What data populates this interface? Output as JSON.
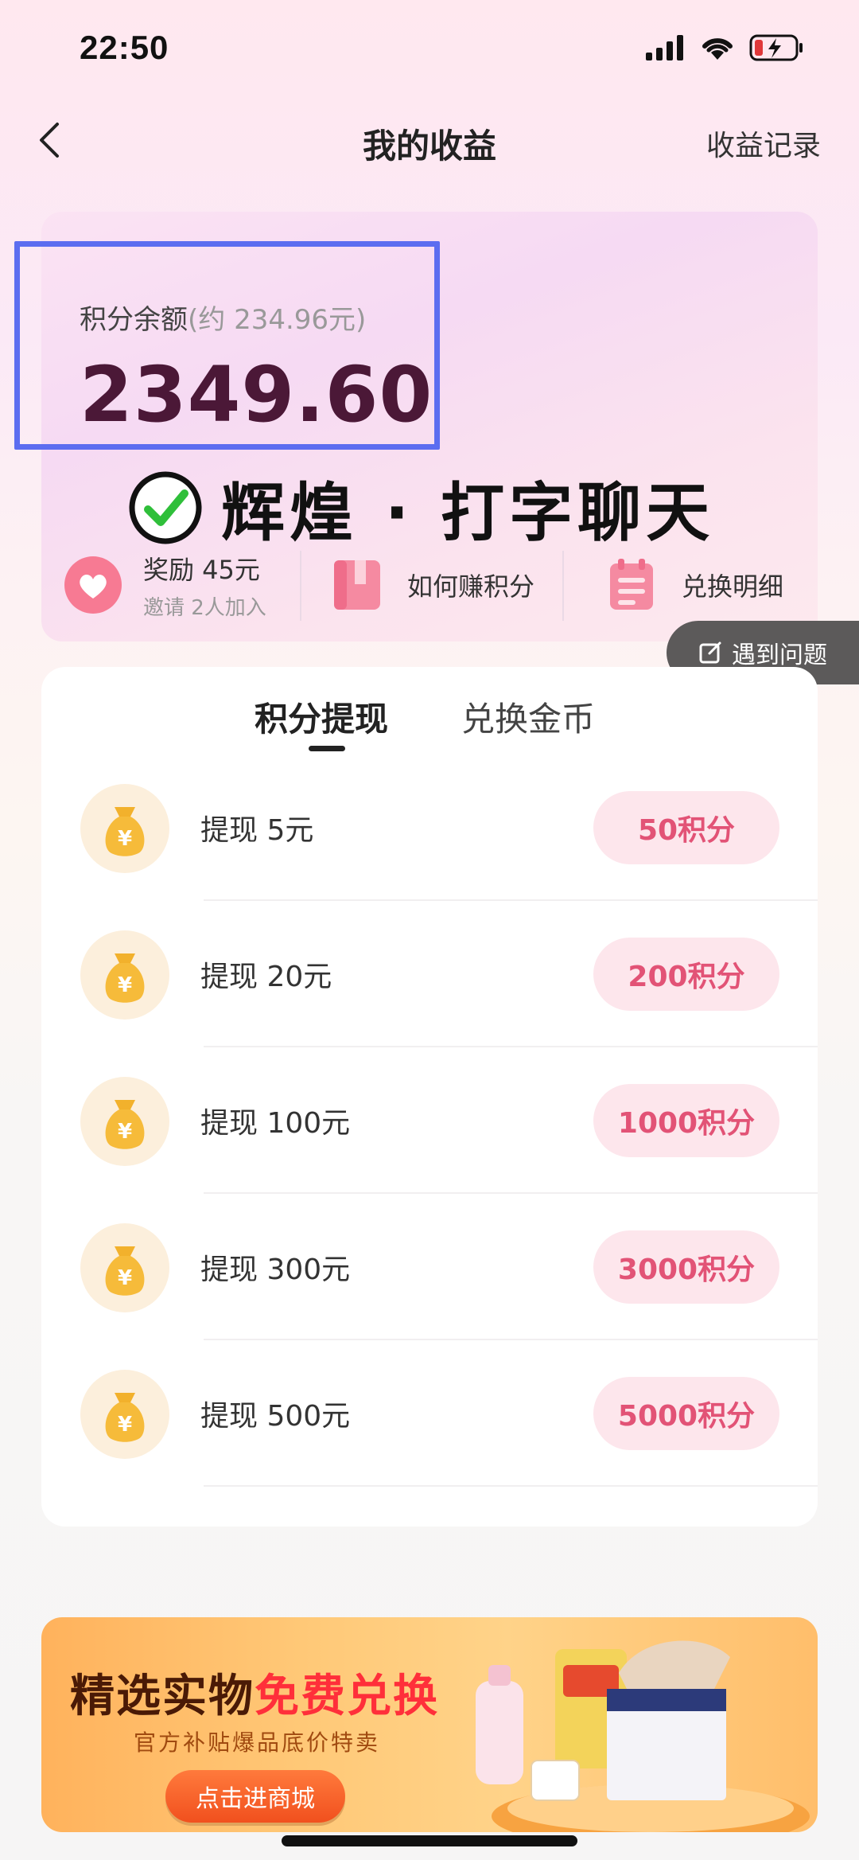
{
  "status_bar": {
    "time": "22:50"
  },
  "nav": {
    "title": "我的收益",
    "right_link": "收益记录"
  },
  "balance": {
    "label": "积分余额",
    "approx": "(约 234.96元)",
    "amount": "2349.60"
  },
  "watermark": {
    "text": "辉煌 · 打字聊天"
  },
  "quick_actions": [
    {
      "title": "奖励 45元",
      "subtitle": "邀请 2人加入",
      "icon": "heart-icon"
    },
    {
      "title": "如何赚积分",
      "icon": "book-icon"
    },
    {
      "title": "兑换明细",
      "icon": "list-icon"
    }
  ],
  "help_button": {
    "label": "遇到问题",
    "icon": "edit-icon"
  },
  "tabs": [
    {
      "label": "积分提现",
      "active": true
    },
    {
      "label": "兑换金币",
      "active": false
    }
  ],
  "withdraw_options": [
    {
      "label": "提现 5元",
      "cost": "50积分"
    },
    {
      "label": "提现 20元",
      "cost": "200积分"
    },
    {
      "label": "提现 100元",
      "cost": "1000积分"
    },
    {
      "label": "提现 300元",
      "cost": "3000积分"
    },
    {
      "label": "提现 500元",
      "cost": "5000积分"
    }
  ],
  "banner": {
    "title_part1": "精选实物",
    "title_part2": "免费兑换",
    "subtitle": "官方补贴爆品底价特卖",
    "button": "点击进商城"
  },
  "colors": {
    "balance_amount": "#4b1837",
    "button_bg": "#fde6ec",
    "button_text": "#e25376",
    "highlight_border": "#5c6df0"
  }
}
